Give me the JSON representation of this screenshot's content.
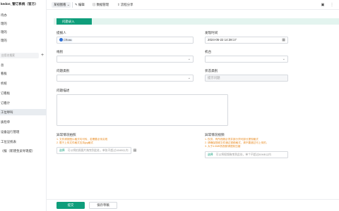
{
  "sidebar": {
    "title": "kedon_管订系统（官方）",
    "items": [
      {
        "label": "待办",
        "active": false
      },
      {
        "label": "理的",
        "active": false
      },
      {
        "label": "理的",
        "active": false
      },
      {
        "label": "理的",
        "active": false
      },
      {
        "label": "看板",
        "active": false
      },
      {
        "label": "析统",
        "active": false
      },
      {
        "label": "订看板",
        "active": false
      },
      {
        "label": "订看计",
        "active": false
      },
      {
        "label": "工位呼叫",
        "active": true
      },
      {
        "label": "质检单",
        "active": false
      },
      {
        "label": "设备运行管理",
        "active": false
      },
      {
        "label": "工位呈统表",
        "active": false
      },
      {
        "label": "《报（新建金员导现提）",
        "active": false
      }
    ],
    "search_placeholder": "应用名搜索",
    "section_label": "总"
  },
  "topbar": {
    "view_label": "某视图看",
    "edit_label": "编辑",
    "data_manage_label": "数据管理",
    "share_label": "流程分享"
  },
  "tab": {
    "label": "问题录入"
  },
  "form": {
    "reporter": {
      "label": "提报人",
      "value": "CRoss"
    },
    "time": {
      "label": "发现时间",
      "value": "2024-05-22 14:38:17"
    },
    "line": {
      "label": "线别",
      "value": ""
    },
    "station": {
      "label": "机台",
      "value": ""
    },
    "category": {
      "label": "问题类别",
      "value": ""
    },
    "status": {
      "label": "状态类别",
      "value": "提示问题"
    },
    "description": {
      "label": "问题描述",
      "value": ""
    },
    "photo": {
      "label": "异常情况拍照",
      "notes": [
        "1. 文件请按图片格式均可传，若需要必传实现",
        "2. 限于上传文件格式支持jpg格式"
      ],
      "pick_label": "选择",
      "hint": "可以将拍照图片拖曳到此处，单张不超过10MB以内"
    },
    "video": {
      "label": "异常情况视频",
      "notes": [
        "1. 仅供，有所视频必须并部分须可部分提现格式",
        "2. 请确保视频文件通过视频格式，请不要超过可上传的，",
        "3. 大于4.0MB的视频请提前压缩"
      ],
      "pick_label": "选择",
      "hint": "可以将视频拖曳到此处，单个不超过80MB以内"
    }
  },
  "footer": {
    "submit_label": "提交",
    "draft_label": "保存草稿"
  },
  "colors": {
    "accent": "#0f9e7b",
    "tab_bg": "#e3f4ef",
    "warning": "#e8891e"
  }
}
